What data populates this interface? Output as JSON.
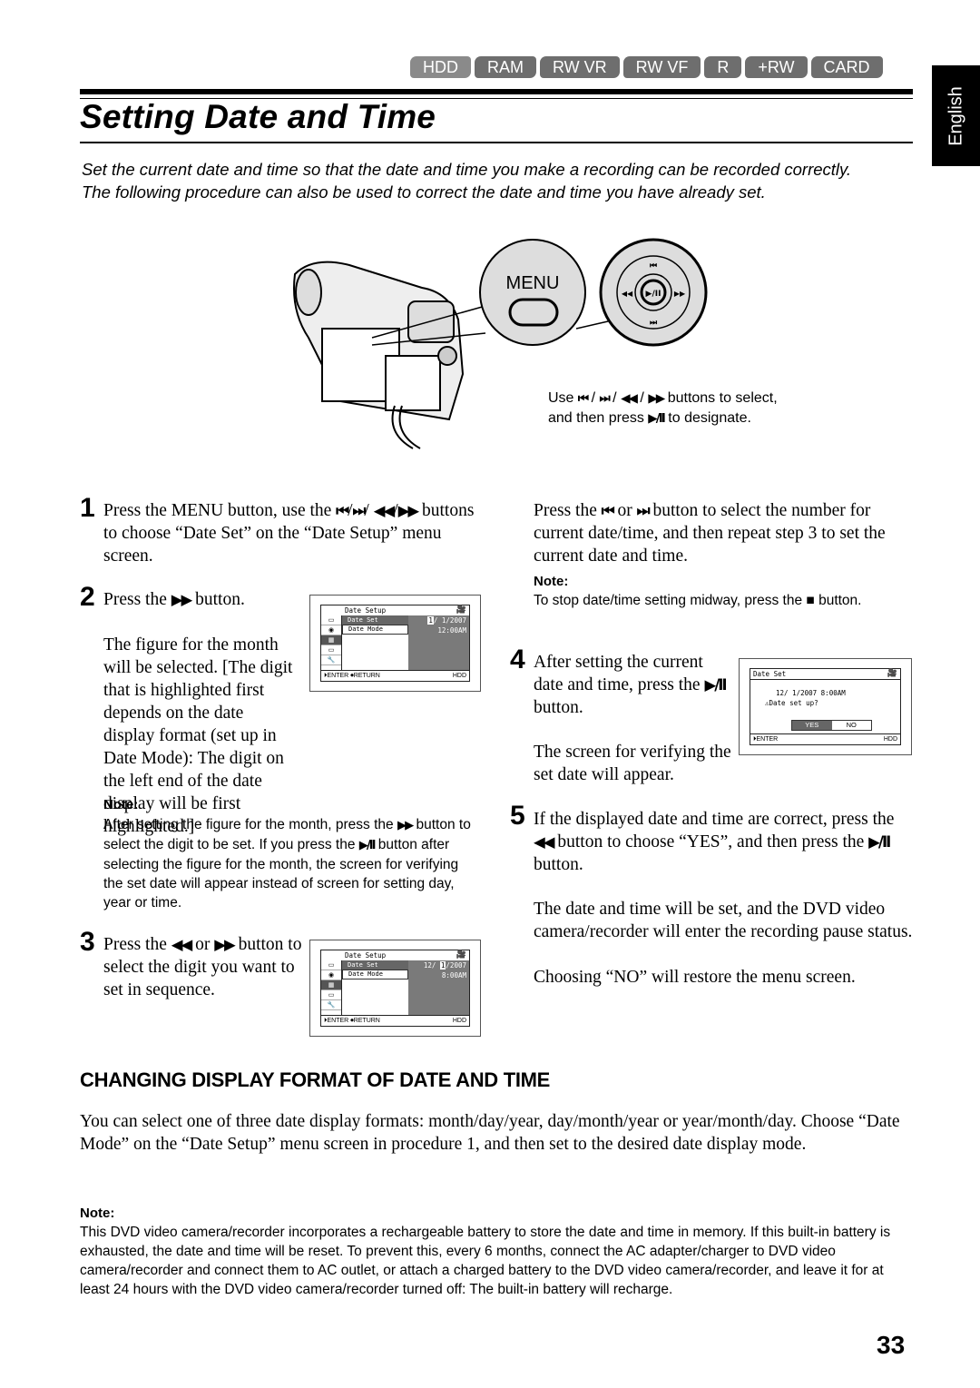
{
  "media_tabs": [
    "HDD",
    "RAM",
    "RW VR",
    "RW VF",
    "R",
    "+RW",
    "CARD"
  ],
  "language_tab": "English",
  "title": "Setting Date and Time",
  "intro": [
    "Set the current date and time so that the date and time you make a recording can be recorded correctly.",
    "The following procedure can also be used to correct the date and time you have already set."
  ],
  "illustration": {
    "menu_label": "MENU",
    "dial_center": "▶/II",
    "caption_parts": [
      "Use ",
      "⏮",
      " / ",
      "⏭",
      " / ",
      "◀◀",
      " / ",
      "▶▶",
      " buttons to select, and then press ",
      "▶/II",
      " to designate."
    ]
  },
  "steps": {
    "s1": {
      "num": "1",
      "a": "Press the MENU button, use the ",
      "i1": "⏮",
      "sep1": "/",
      "i2": "⏭",
      "sep2": "/",
      "i3": "◀◀",
      "sep3": "/",
      "i4": "▶▶",
      "b": " buttons to choose “Date Set” on the “Date Setup” menu screen."
    },
    "s2": {
      "num": "2",
      "a": "Press the ",
      "i1": "▶▶",
      "b": " button.",
      "c": "The figure for the month will be selected. [The digit that is highlighted first depends on the date display format (set up in Date Mode): The digit on the left end of the date display will be first highlighted.]"
    },
    "note1": {
      "label": "Note:",
      "a": "After setting the figure for the month, press the ",
      "i1": "▶▶",
      "b": " button to select the digit to be set. If you press the ",
      "i2": "▶/II",
      "c": " button after selecting the figure for the month, the screen for verifying the set date will appear instead of screen for setting day, year or time."
    },
    "s3": {
      "num": "3",
      "a": "Press the ",
      "i1": "◀◀",
      "or": " or ",
      "i2": "▶▶",
      "b": " button to select the digit you want to set in sequence."
    },
    "s3b": {
      "a": "Press the ",
      "i1": "⏮",
      "or": " or ",
      "i2": "⏭",
      "b": " button to select the number for current date/time, and then repeat step 3 to set the current date and time."
    },
    "note2": {
      "label": "Note:",
      "a": "To stop date/time setting midway, press the ",
      "i1": "■",
      "b": " button."
    },
    "s4": {
      "num": "4",
      "a": "After setting the current date and time, press the ",
      "i1": "▶/II",
      "b": " button.",
      "c": "The screen for verifying the set date will appear."
    },
    "s5": {
      "num": "5",
      "a": "If the displayed date and time are correct, press the ",
      "i1": "◀◀",
      "b": " button to choose “YES”, and then press the ",
      "i2": "▶/II",
      "c": " button.",
      "d": "The date and time will be set, and the DVD video camera/recorder will enter the recording pause status.",
      "e": "Choosing “NO” will restore the menu screen."
    }
  },
  "screens": {
    "screen1": {
      "title": "Date Setup",
      "items": [
        "Date Set",
        "Date Mode"
      ],
      "date_pre": "",
      "date_hl": "1",
      "date_post": "/ 1/2007",
      "time": "12:00AM",
      "footer_enter": "ENTER",
      "footer_return": "RETURN",
      "footer_media": "HDD"
    },
    "screen2": {
      "title": "Date Setup",
      "items": [
        "Date Set",
        "Date Mode"
      ],
      "date_pre": "12/ ",
      "date_hl": "1",
      "date_post": "/2007",
      "time": "8:00AM",
      "footer_enter": "ENTER",
      "footer_return": "RETURN",
      "footer_media": "HDD"
    },
    "screen3": {
      "title": "Date Set",
      "datetime": "12/ 1/2007 8:00AM",
      "question": "Date set up?",
      "yes": "YES",
      "no": "NO",
      "footer_enter": "ENTER",
      "footer_media": "HDD"
    }
  },
  "section2": {
    "heading": "CHANGING DISPLAY FORMAT OF DATE AND TIME",
    "body": "You can select one of three date display formats: month/day/year, day/month/year or year/month/day. Choose “Date Mode” on the “Date Setup” menu screen in procedure 1, and then set to the desired date display mode.",
    "note_label": "Note:",
    "note": "This DVD video camera/recorder incorporates a rechargeable battery to store the date and time in memory. If this built-in battery is exhausted, the date and time will be reset. To prevent this, every 6 months, connect the AC adapter/charger to DVD video camera/recorder and connect them to AC outlet, or attach a charged battery to the DVD video camera/recorder, and leave it for at least 24 hours with the DVD video camera/recorder turned off: The built-in battery will recharge."
  },
  "page_number": "33"
}
